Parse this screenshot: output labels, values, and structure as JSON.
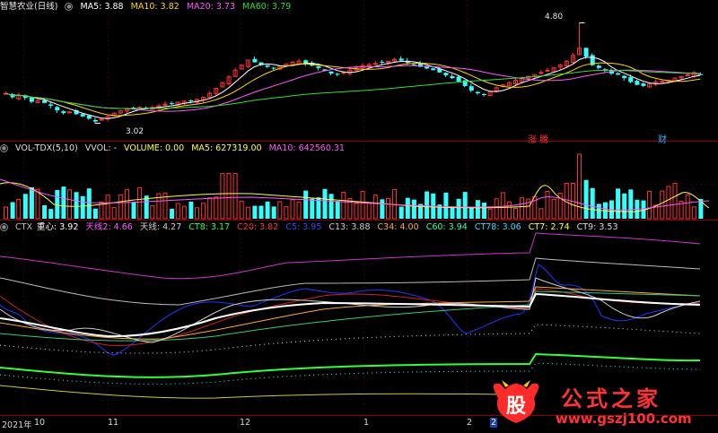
{
  "panel1": {
    "title": "智慧农业(日线)",
    "ma": [
      {
        "label": "MA5: 3.88",
        "color": "#ffffff"
      },
      {
        "label": "MA10: 3.82",
        "color": "#ffd700"
      },
      {
        "label": "MA20: 3.73",
        "color": "#ff55ff"
      },
      {
        "label": "MA60: 3.79",
        "color": "#33dd33"
      }
    ],
    "high_label": "4.80",
    "low_label": "3.02",
    "tags": [
      {
        "text": "涨 腾",
        "color": "#ff3333"
      },
      {
        "text": "财",
        "color": "#33aaff"
      }
    ]
  },
  "panel2": {
    "name": "VOL-TDX(5,10)",
    "vvol": "VVOL: -",
    "volume": "VOLUME: 0.00",
    "ma5": "MA5: 627319.00",
    "ma10": "MA10: 642560.31"
  },
  "panel3": {
    "items": [
      {
        "label": "CTX",
        "color": "#bbbbbb"
      },
      {
        "label": "重心: 3.92",
        "color": "#ffffff"
      },
      {
        "label": "天线2: 4.66",
        "color": "#ff55ff"
      },
      {
        "label": "天线: 4.27",
        "color": "#cccccc"
      },
      {
        "label": "CT8: 3.17",
        "color": "#33ff33"
      },
      {
        "label": "C20: 3.82",
        "color": "#ff3333"
      },
      {
        "label": "C5: 3.95",
        "color": "#3344ff"
      },
      {
        "label": "C13: 3.88",
        "color": "#cccccc"
      },
      {
        "label": "C34: 4.00",
        "color": "#ffaa33"
      },
      {
        "label": "C60: 3.94",
        "color": "#33ff99"
      },
      {
        "label": "CT78: 3.06",
        "color": "#33ddff"
      },
      {
        "label": "CT7: 2.74",
        "color": "#ffff33"
      },
      {
        "label": "CT9: 3.53",
        "color": "#dddddd"
      }
    ]
  },
  "x_axis": [
    {
      "label": "2021年"
    },
    {
      "label": "10"
    },
    {
      "label": "11"
    },
    {
      "label": "12"
    },
    {
      "label": "1"
    },
    {
      "label": "2"
    },
    {
      "label": "2"
    }
  ],
  "watermark": {
    "logo": "股",
    "title": "公式之家",
    "url": "www.gszj100.com"
  },
  "chart_data": {
    "type": "candlestick",
    "title": "智慧农业(日线)",
    "ylim": [
      2.9,
      4.95
    ],
    "close": [
      3.55,
      3.48,
      3.52,
      3.47,
      3.4,
      3.42,
      3.38,
      3.33,
      3.25,
      3.2,
      3.22,
      3.18,
      3.14,
      3.1,
      3.05,
      3.09,
      3.14,
      3.2,
      3.24,
      3.27,
      3.29,
      3.3,
      3.28,
      3.3,
      3.33,
      3.36,
      3.37,
      3.39,
      3.41,
      3.42,
      3.44,
      3.48,
      3.55,
      3.64,
      3.74,
      3.84,
      3.96,
      4.05,
      4.14,
      4.1,
      4.05,
      4.02,
      4.0,
      4.03,
      4.07,
      4.1,
      4.12,
      4.08,
      4.04,
      4.0,
      3.95,
      3.9,
      3.88,
      3.92,
      3.96,
      4.0,
      4.04,
      4.06,
      4.08,
      4.1,
      4.12,
      4.15,
      4.13,
      4.09,
      4.06,
      4.02,
      3.99,
      3.96,
      3.92,
      3.87,
      3.82,
      3.76,
      3.68,
      3.6,
      3.55,
      3.52,
      3.58,
      3.65,
      3.7,
      3.74,
      3.78,
      3.82,
      3.85,
      3.88,
      3.92,
      3.96,
      4.0,
      4.05,
      4.12,
      4.22,
      4.35,
      4.2,
      4.05,
      4.0,
      3.95,
      3.9,
      3.88,
      3.82,
      3.75,
      3.7,
      3.68,
      3.72,
      3.75,
      3.76,
      3.78,
      3.82,
      3.85,
      3.88,
      3.92,
      3.88
    ],
    "volume_ma5": 627319.0,
    "volume_ma10": 642560.31
  }
}
